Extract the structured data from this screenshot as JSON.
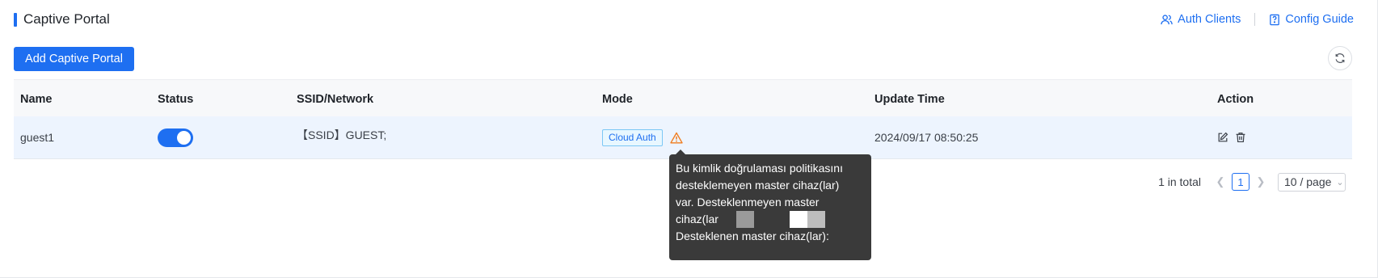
{
  "header": {
    "title": "Captive Portal",
    "auth_clients_label": "Auth Clients",
    "config_guide_label": "Config Guide"
  },
  "toolbar": {
    "add_label": "Add Captive Portal"
  },
  "table": {
    "columns": [
      "Name",
      "Status",
      "SSID/Network",
      "Mode",
      "Update Time",
      "Action"
    ],
    "rows": [
      {
        "name": "guest1",
        "status_enabled": true,
        "ssid": "【SSID】GUEST;",
        "mode": "Cloud Auth",
        "update_time": "2024/09/17 08:50:25"
      }
    ]
  },
  "pagination": {
    "total_text": "1 in total",
    "current_page": "1",
    "page_size": "10 / page"
  },
  "tooltip": {
    "line1": "Bu kimlik doğrulaması politikasını",
    "line2": "desteklemeyen master cihaz(lar)",
    "line3": "var. Desteklenmeyen master",
    "line4": "cihaz(lar",
    "line5": "Desteklenen master cihaz(lar):"
  },
  "colors": {
    "accent": "#1e6ff1",
    "row_highlight": "#edf4fe",
    "warning": "#f07c1f",
    "tooltip_bg": "#3a3a3a"
  },
  "icons": [
    "users-icon",
    "book-icon",
    "refresh-icon",
    "warning-icon",
    "edit-icon",
    "delete-icon",
    "chevron-left-icon",
    "chevron-right-icon",
    "chevron-down-icon"
  ]
}
